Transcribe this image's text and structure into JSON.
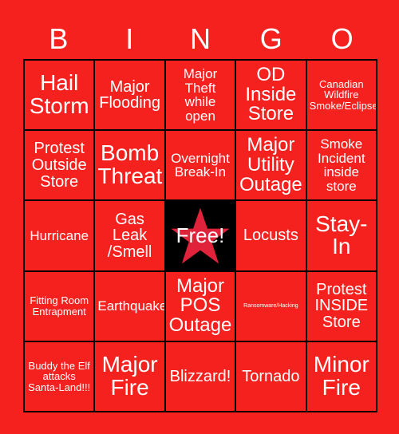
{
  "page": {
    "background_color": "#F4211E",
    "text_color": "#FFFFFF",
    "border_color": "#000000",
    "free_space_background": "#000000",
    "free_space_star_color": "#E0223A"
  },
  "header": {
    "letters": [
      "B",
      "I",
      "N",
      "G",
      "O"
    ]
  },
  "card": {
    "rows": [
      [
        {
          "text": "Hail Storm",
          "size": "xl"
        },
        {
          "text": "Major Flooding",
          "size": "md"
        },
        {
          "text": "Major Theft while open",
          "size": "sm"
        },
        {
          "text": "OD Inside Store",
          "size": "lg"
        },
        {
          "text": "Canadian Wildfire Smoke/Eclipse",
          "size": "xs"
        }
      ],
      [
        {
          "text": "Protest Outside Store",
          "size": "md"
        },
        {
          "text": "Bomb Threat",
          "size": "xl"
        },
        {
          "text": "Overnight Break-In",
          "size": "sm"
        },
        {
          "text": "Major Utility Outage",
          "size": "lg"
        },
        {
          "text": "Smoke Incident inside store",
          "size": "sm"
        }
      ],
      [
        {
          "text": "Hurricane",
          "size": "sm"
        },
        {
          "text": "Gas Leak /Smell",
          "size": "md"
        },
        {
          "text": "Free!",
          "size": "free",
          "free": true
        },
        {
          "text": "Locusts",
          "size": "md"
        },
        {
          "text": "Stay-In",
          "size": "xl"
        }
      ],
      [
        {
          "text": "Fitting Room Entrapment",
          "size": "xs"
        },
        {
          "text": "Earthquake",
          "size": "sm"
        },
        {
          "text": "Major POS Outage",
          "size": "lg"
        },
        {
          "text": "Ransomware/Hacking",
          "size": "xxs"
        },
        {
          "text": "Protest INSIDE Store",
          "size": "md"
        }
      ],
      [
        {
          "text": "Buddy the Elf attacks Santa-Land!!!",
          "size": "xs"
        },
        {
          "text": "Major Fire",
          "size": "xl"
        },
        {
          "text": "Blizzard!",
          "size": "md"
        },
        {
          "text": "Tornado",
          "size": "md"
        },
        {
          "text": "Minor Fire",
          "size": "xl"
        }
      ]
    ]
  }
}
